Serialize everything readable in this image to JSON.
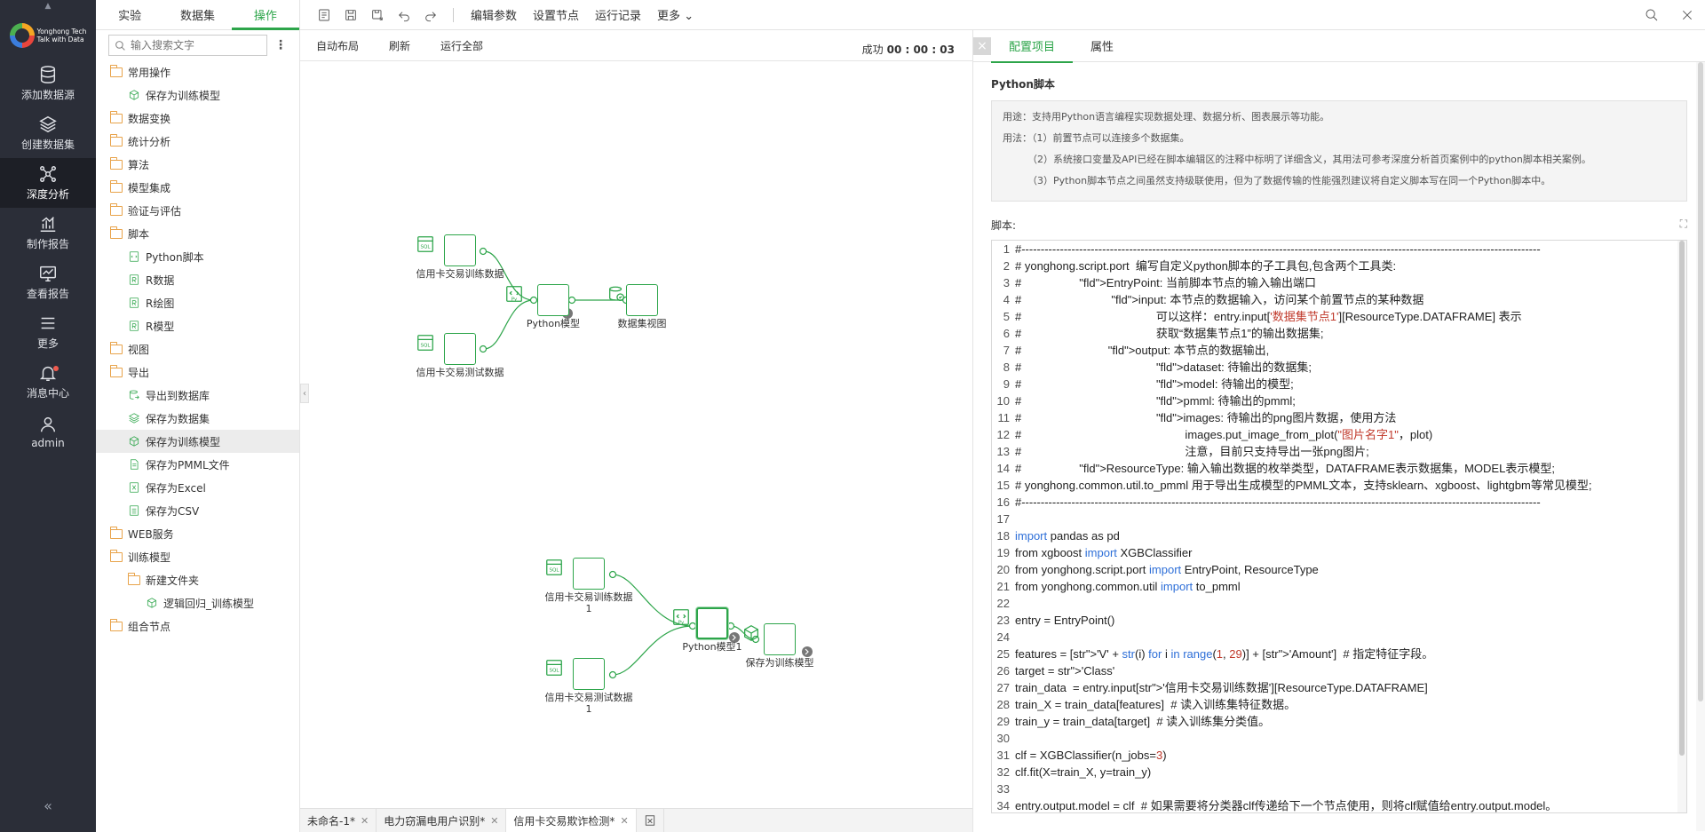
{
  "nav": {
    "brand_line1": "Yonghong Tech",
    "brand_line2": "Talk with Data",
    "items": [
      {
        "label": "添加数据源",
        "icon": "database-icon"
      },
      {
        "label": "创建数据集",
        "icon": "layers-icon"
      },
      {
        "label": "深度分析",
        "icon": "network-icon"
      },
      {
        "label": "制作报告",
        "icon": "bar-chart-icon"
      },
      {
        "label": "查看报告",
        "icon": "report-icon"
      },
      {
        "label": "更多",
        "icon": "menu-icon"
      },
      {
        "label": "消息中心",
        "icon": "bell-icon"
      },
      {
        "label": "admin",
        "icon": "user-icon"
      }
    ],
    "active_index": 2,
    "collapse_glyph": "«"
  },
  "left_panel": {
    "tabs": [
      "实验",
      "数据集",
      "操作"
    ],
    "active_tab": 2,
    "search_placeholder": "输入搜索文字",
    "tree": [
      {
        "label": "常用操作",
        "level": 0,
        "type": "folder"
      },
      {
        "label": "保存为训练模型",
        "level": 1,
        "type": "model-save"
      },
      {
        "label": "数据变换",
        "level": 0,
        "type": "folder"
      },
      {
        "label": "统计分析",
        "level": 0,
        "type": "folder"
      },
      {
        "label": "算法",
        "level": 0,
        "type": "folder"
      },
      {
        "label": "模型集成",
        "level": 0,
        "type": "folder"
      },
      {
        "label": "验证与评估",
        "level": 0,
        "type": "folder"
      },
      {
        "label": "脚本",
        "level": 0,
        "type": "folder"
      },
      {
        "label": "Python脚本",
        "level": 1,
        "type": "python"
      },
      {
        "label": "R数据",
        "level": 1,
        "type": "r"
      },
      {
        "label": "R绘图",
        "level": 1,
        "type": "r"
      },
      {
        "label": "R模型",
        "level": 1,
        "type": "r"
      },
      {
        "label": "视图",
        "level": 0,
        "type": "folder"
      },
      {
        "label": "导出",
        "level": 0,
        "type": "folder"
      },
      {
        "label": "导出到数据库",
        "level": 1,
        "type": "export-db"
      },
      {
        "label": "保存为数据集",
        "level": 1,
        "type": "dataset-save"
      },
      {
        "label": "保存为训练模型",
        "level": 1,
        "type": "model-save",
        "selected": true
      },
      {
        "label": "保存为PMML文件",
        "level": 1,
        "type": "file"
      },
      {
        "label": "保存为Excel",
        "level": 1,
        "type": "excel"
      },
      {
        "label": "保存为CSV",
        "level": 1,
        "type": "csv"
      },
      {
        "label": "WEB服务",
        "level": 0,
        "type": "folder"
      },
      {
        "label": "训练模型",
        "level": 0,
        "type": "folder"
      },
      {
        "label": "新建文件夹",
        "level": 1,
        "type": "folder"
      },
      {
        "label": "逻辑回归_训练模型",
        "level": 2,
        "type": "model-save"
      },
      {
        "label": "组合节点",
        "level": 0,
        "type": "folder"
      }
    ]
  },
  "toolbar": {
    "edit_params": "编辑参数",
    "set_node": "设置节点",
    "run_log": "运行记录",
    "more": "更多"
  },
  "subbar": {
    "auto_layout": "自动布局",
    "refresh": "刷新",
    "run_all": "运行全部",
    "status_label": "成功",
    "status_time": "00 : 00 : 03"
  },
  "graph": {
    "nodes": [
      {
        "id": "n1",
        "label": "信用卡交易训练数据",
        "kind": "sql"
      },
      {
        "id": "n2",
        "label": "Python模型",
        "kind": "python"
      },
      {
        "id": "n3",
        "label": "数据集视图",
        "kind": "dataset-view"
      },
      {
        "id": "n4",
        "label": "信用卡交易测试数据",
        "kind": "sql"
      },
      {
        "id": "n5",
        "label": "信用卡交易训练数据1",
        "kind": "sql"
      },
      {
        "id": "n6",
        "label": "信用卡交易测试数据1",
        "kind": "sql"
      },
      {
        "id": "n7",
        "label": "Python模型1",
        "kind": "python"
      },
      {
        "id": "n8",
        "label": "保存为训练模型",
        "kind": "model-save"
      }
    ]
  },
  "bottom_tabs": [
    {
      "label": "未命名-1*",
      "active": false
    },
    {
      "label": "电力窃漏电用户识别*",
      "active": false
    },
    {
      "label": "信用卡交易欺诈检测*",
      "active": true
    }
  ],
  "right_panel": {
    "tabs": [
      "配置项目",
      "属性"
    ],
    "active_tab": 0,
    "title": "Python脚本",
    "desc": [
      "用途：支持用Python语言编程实现数据处理、数据分析、图表展示等功能。",
      "用法：（1）前置节点可以连接多个数据集。",
      "（2）系统接口变量及API已经在脚本编辑区的注释中标明了详细含义，其用法可参考深度分析首页案例中的python脚本相关案例。",
      "（3）Python脚本节点之间虽然支持级联使用，但为了数据传输的性能强烈建议将自定义脚本写在同一个Python脚本中。"
    ],
    "script_label": "脚本:",
    "code": [
      "#---------------------------------------------------------------------------------------------------------------------------------------",
      "# yonghong.script.port  编写自定义python脚本的子工具包,包含两个工具类:",
      "#                  EntryPoint: 当前脚本节点的输入输出端口",
      "#                            input: 本节点的数据输入，访问某个前置节点的某种数据",
      "#                                          可以这样：entry.input['数据集节点1'][ResourceType.DATAFRAME] 表示",
      "#                                          获取“数据集节点1”的输出数据集;",
      "#                           output: 本节点的数据输出,",
      "#                                          dataset: 待输出的数据集;",
      "#                                          model: 待输出的模型;",
      "#                                          pmml: 待输出的pmml;",
      "#                                          images: 待输出的png图片数据，使用方法",
      "#                                                   images.put_image_from_plot(\"图片名字1\"，plot)",
      "#                                                   注意，目前只支持导出一张png图片;",
      "#                  ResourceType: 输入输出数据的枚举类型，DATAFRAME表示数据集，MODEL表示模型;",
      "# yonghong.common.util.to_pmml 用于导出生成模型的PMML文本，支持sklearn、xgboost、lightgbm等常见模型;",
      "#---------------------------------------------------------------------------------------------------------------------------------------",
      "",
      "import pandas as pd",
      "from xgboost import XGBClassifier",
      "from yonghong.script.port import EntryPoint, ResourceType",
      "from yonghong.common.util import to_pmml",
      "",
      "entry = EntryPoint()",
      "",
      "features = ['V' + str(i) for i in range(1, 29)] + ['Amount']  # 指定特征字段。",
      "target = 'Class'",
      "train_data  = entry.input['信用卡交易训练数据'][ResourceType.DATAFRAME]",
      "train_X = train_data[features]  # 读入训练集特征数据。",
      "train_y = train_data[target]  # 读入训练集分类值。",
      "",
      "clf = XGBClassifier(n_jobs=3)",
      "clf.fit(X=train_X, y=train_y)",
      "",
      "entry.output.model = clf  # 如果需要将分类器clf传递给下一个节点使用，则将clf赋值给entry.output.model。"
    ]
  },
  "colors": {
    "accent": "#2da54a",
    "nav_bg": "#2b2e38",
    "folder": "#e8a34a"
  }
}
